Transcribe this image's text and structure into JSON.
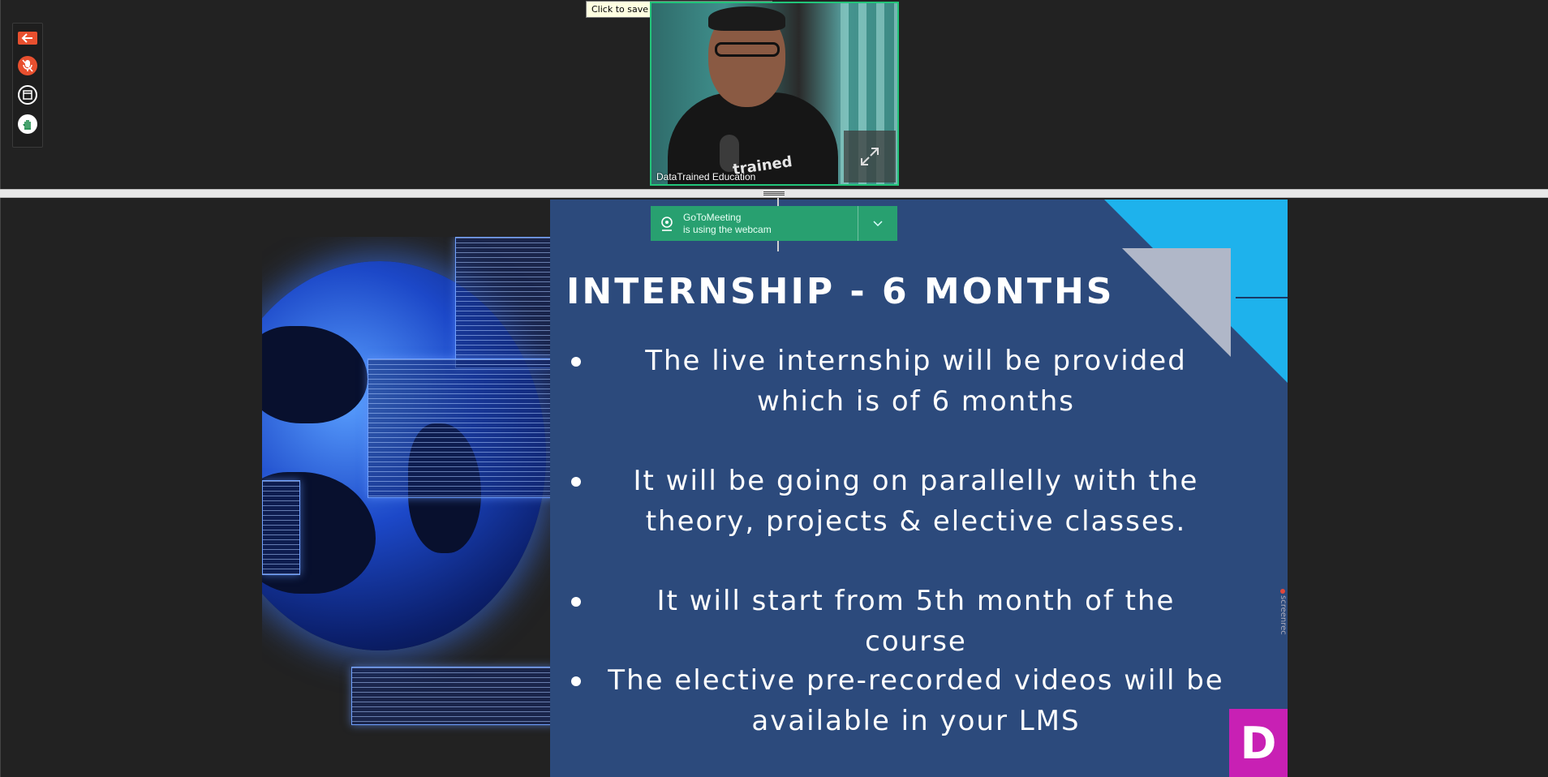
{
  "tooltip": {
    "text": "Click to save a picture to your desktop."
  },
  "toolbar": {
    "items": [
      {
        "icon": "arrow-left-icon"
      },
      {
        "icon": "microphone-muted-icon"
      },
      {
        "icon": "window-icon"
      },
      {
        "icon": "hand-raise-icon"
      }
    ]
  },
  "webcam": {
    "participant_name": "DataTrained Education",
    "shirt_text": "trained",
    "expand_icon": "expand-icon"
  },
  "notification": {
    "line1": "GoToMeeting",
    "line2": "is using the webcam",
    "icon": "webcam-icon",
    "chevron": "chevron-down-icon",
    "color": "#28a070"
  },
  "slide": {
    "title": "INTERNSHIP - 6 MONTHS",
    "bullets": [
      "The live internship will be provided which is of 6 months",
      "It will be going on parallelly with the theory, projects & elective classes.",
      "It will start from 5th month of the course",
      "The elective pre-recorded videos will be available in your LMS"
    ],
    "logo_letter": "D",
    "watermark": "screenrec",
    "colors": {
      "background": "#2c4a7c",
      "accent_cyan": "#1eb2ec",
      "accent_magenta": "#c820b4"
    }
  }
}
